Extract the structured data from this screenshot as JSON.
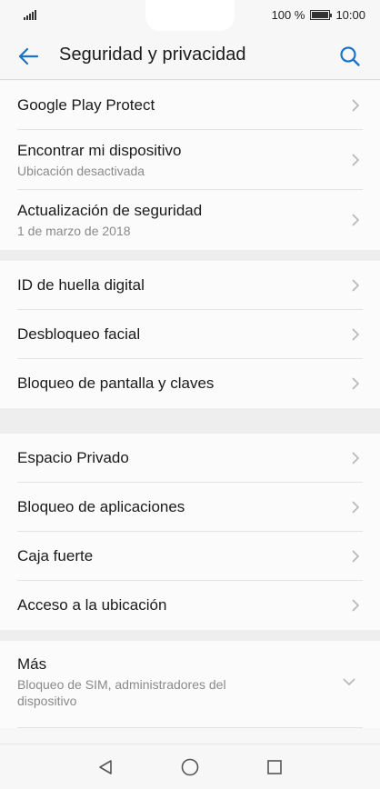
{
  "status_bar": {
    "battery": "100 %",
    "battery_level": 1.0,
    "time": "10:00"
  },
  "header": {
    "title": "Seguridad y privacidad",
    "back_icon": "arrow-left-icon",
    "search_icon": "search-icon"
  },
  "colors": {
    "accent": "#1a73c8",
    "background": "#f7f7f7",
    "divider": "#eeeeee"
  },
  "groups": [
    {
      "items": [
        {
          "label": "Google Play Protect"
        },
        {
          "label": "Encontrar mi dispositivo",
          "sub": "Ubicación desactivada"
        },
        {
          "label": "Actualización de seguridad",
          "sub": "1 de marzo de 2018"
        }
      ]
    },
    {
      "items": [
        {
          "label": "ID de huella digital"
        },
        {
          "label": "Desbloqueo facial"
        },
        {
          "label": "Bloqueo de pantalla y claves"
        }
      ]
    },
    {
      "items": [
        {
          "label": "Espacio Privado"
        },
        {
          "label": "Bloqueo de aplicaciones"
        },
        {
          "label": "Caja fuerte"
        },
        {
          "label": "Acceso a la ubicación"
        }
      ]
    },
    {
      "items": [
        {
          "label": "Más",
          "sub": "Bloqueo de SIM, administradores del dispositivo"
        }
      ]
    }
  ],
  "nav_bar": {
    "back": "triangle-back-icon",
    "home": "circle-home-icon",
    "recents": "square-recents-icon"
  }
}
